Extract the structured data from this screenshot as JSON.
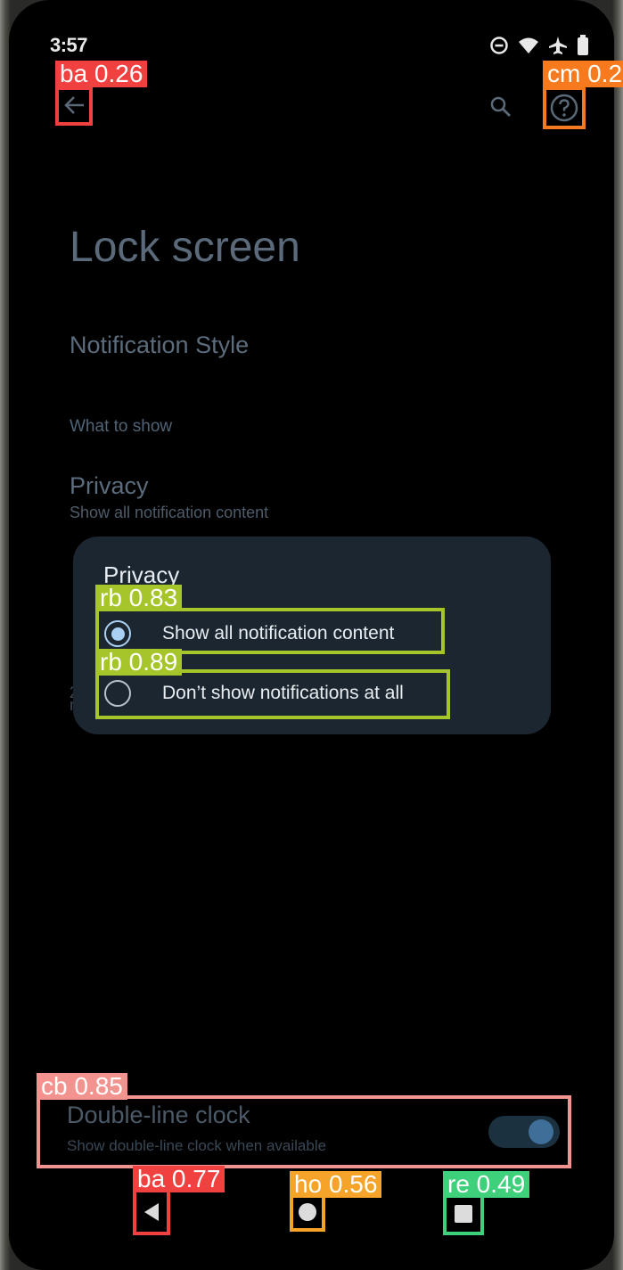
{
  "status_bar": {
    "time": "3:57"
  },
  "toolbar": {
    "back_icon": "arrow-left-icon",
    "search_icon": "search-icon",
    "help_icon": "help-circle-icon"
  },
  "page": {
    "title": "Lock screen"
  },
  "settings": {
    "notification_style": "Notification Style",
    "category": "What to show",
    "privacy": {
      "title": "Privacy",
      "summary": "Show all notification content"
    },
    "double_line_clock": {
      "title": "Double-line clock",
      "summary": "Show double-line clock when available",
      "enabled": true
    }
  },
  "dialog": {
    "title": "Privacy",
    "options": [
      {
        "label": "Show all notification content",
        "selected": true
      },
      {
        "label": "Don’t show notifications at all",
        "selected": false
      }
    ]
  },
  "detections": [
    {
      "label": "ba 0.26",
      "color": "#f04040"
    },
    {
      "label": "cm 0.2",
      "color": "#f77a1e"
    },
    {
      "label": "rb 0.83",
      "color": "#a6c52a"
    },
    {
      "label": "rb 0.89",
      "color": "#a6c52a"
    },
    {
      "label": "cb 0.85",
      "color": "#f2938f"
    },
    {
      "label": "ba 0.77",
      "color": "#f04040"
    },
    {
      "label": "ho 0.56",
      "color": "#f6a32a"
    },
    {
      "label": "re 0.49",
      "color": "#3ed07a"
    }
  ],
  "nav_bar": {
    "back": "triangle-back-icon",
    "home": "circle-home-icon",
    "recents": "square-recents-icon"
  }
}
